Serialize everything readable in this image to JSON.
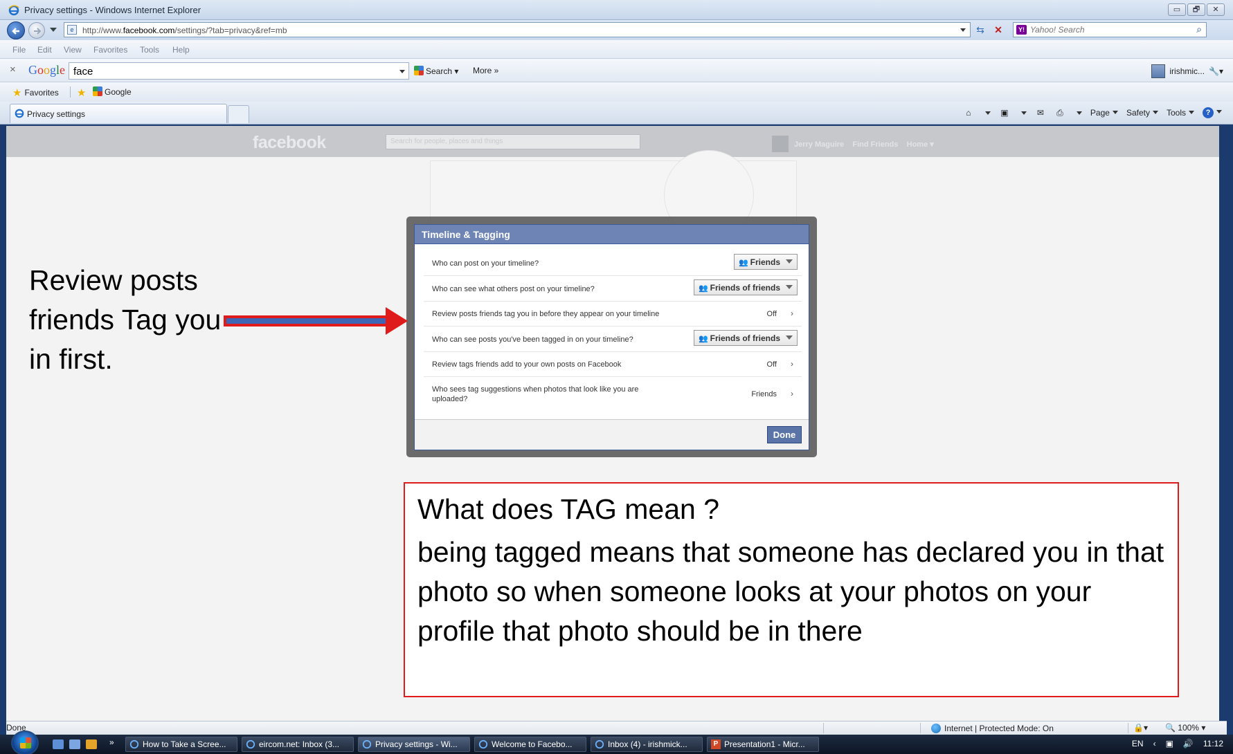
{
  "window": {
    "title": "Privacy settings - Windows Internet Explorer",
    "buttons": [
      "▭",
      "🗗",
      "✕"
    ]
  },
  "address": {
    "url_prefix": "http://www.",
    "url_domain": "facebook.com",
    "url_rest": "/settings/?tab=privacy&ref=mb",
    "search_placeholder": "Yahoo! Search"
  },
  "menu": {
    "items": [
      "File",
      "Edit",
      "View",
      "Favorites",
      "Tools",
      "Help"
    ]
  },
  "google_toolbar": {
    "query": "face",
    "search_label": "Search",
    "more_label": "More »",
    "user": "irishmic..."
  },
  "favorites": {
    "favorites_label": "Favorites",
    "google_label": "Google"
  },
  "tab": {
    "label": "Privacy settings"
  },
  "command_bar": {
    "page": "Page",
    "safety": "Safety",
    "tools": "Tools"
  },
  "facebook": {
    "logo": "facebook",
    "search_placeholder": "Search for people, places and things",
    "user_name": "Jerry Maguire",
    "find_friends": "Find Friends",
    "home": "Home"
  },
  "dialog": {
    "title": "Timeline & Tagging",
    "rows": [
      {
        "question": "Who can post on your timeline?",
        "value": "Friends"
      },
      {
        "question": "Who can see what others post on your timeline?",
        "value": "Friends of friends"
      },
      {
        "question": "Review posts friends tag you in before they appear on your timeline",
        "value": "Off"
      },
      {
        "question": "Who can see posts you've been tagged in on your timeline?",
        "value": "Friends of friends"
      },
      {
        "question": "Review tags friends add to your own posts on Facebook",
        "value": "Off"
      },
      {
        "question": "Who sees tag suggestions when photos that look like you are uploaded?",
        "value": "Friends"
      }
    ],
    "done_label": "Done"
  },
  "annotation": {
    "review_text": "Review posts friends Tag you in first.",
    "question": "What does TAG mean ?",
    "answer": "being tagged means that someone has declared you in that photo so when someone looks at your photos on your profile that photo should be in there",
    "arrow_color": "#e01b1b"
  },
  "status": {
    "left": "Done",
    "zone": "Internet | Protected Mode: On",
    "zoom": "100%"
  },
  "taskbar": {
    "items": [
      "How to Take a Scree...",
      "eircom.net: Inbox (3...",
      "Privacy settings - Wi...",
      "Welcome to Facebo...",
      "Inbox (4) - irishmick...",
      "Presentation1 - Micr..."
    ],
    "lang": "EN",
    "time": "11:12"
  }
}
